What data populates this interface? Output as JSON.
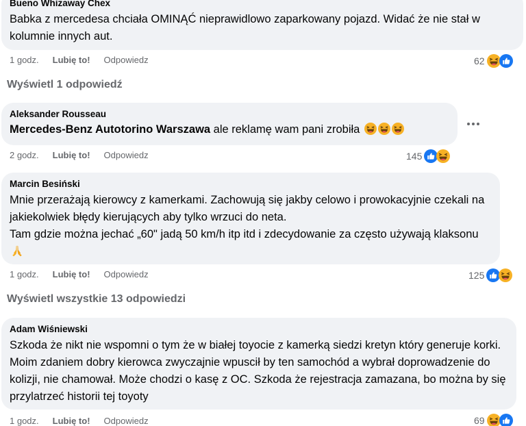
{
  "comments": [
    {
      "author": "Bueno Whizaway Chex",
      "text": "Babka z mercedesa chciała OMINĄĆ nieprawidlowo zaparkowany pojazd. Widać że nie stał w kolumnie innych aut.",
      "time": "1 godz.",
      "like": "Lubię to!",
      "reply": "Odpowiedz",
      "reaction_count": "62",
      "reactions": [
        "haha-icon",
        "like-icon"
      ]
    },
    {
      "author": "Aleksander Rousseau",
      "tag": "Mercedes-Benz Autotorino Warszawa",
      "text": " ale reklamę wam pani zrobiła",
      "time": "2 godz.",
      "like": "Lubię to!",
      "reply": "Odpowiedz",
      "reaction_count": "145",
      "reactions": [
        "like-icon",
        "haha-icon"
      ]
    },
    {
      "author": "Marcin Besiński",
      "text_lines": [
        "Mnie przerażają kierowcy z kamerkami. Zachowują się jakby celowo i prowokacyjnie czekali na jakiekolwiek błędy kierujących aby tylko wrzuci do neta.",
        "Tam gdzie można jechać „60\" jadą 50 km/h itp itd i zdecydowanie za często używają klaksonu"
      ],
      "time": "1 godz.",
      "like": "Lubię to!",
      "reply": "Odpowiedz",
      "reaction_count": "125",
      "reactions": [
        "like-icon",
        "haha-icon"
      ]
    },
    {
      "author": "Adam Wiśniewski",
      "text": "Szkoda że nikt nie wspomni o tym że w białej toyocie z kamerką siedzi kretyn który generuje korki. Moim zdaniem dobry kierowca zwyczajnie wpuscił by ten samochód a wybrał doprowadzenie do kolizji, nie chamował. Może chodzi o kasę z OC. Szkoda że rejestracja zamazana, bo można by się przylatrzeć historii tej toyoty",
      "time": "1 godz.",
      "like": "Lubię to!",
      "reply": "Odpowiedz",
      "reaction_count": "69",
      "reactions": [
        "haha-icon",
        "like-icon"
      ]
    }
  ],
  "view_replies_1": "Wyświetl 1 odpowiedź",
  "view_replies_2": "Wyświetl wszystkie 13 odpowiedzi",
  "colors": {
    "bubble": "#f0f2f5",
    "meta": "#65676b",
    "like_blue": "#1877f2",
    "haha_yellow": "#f7b125"
  }
}
